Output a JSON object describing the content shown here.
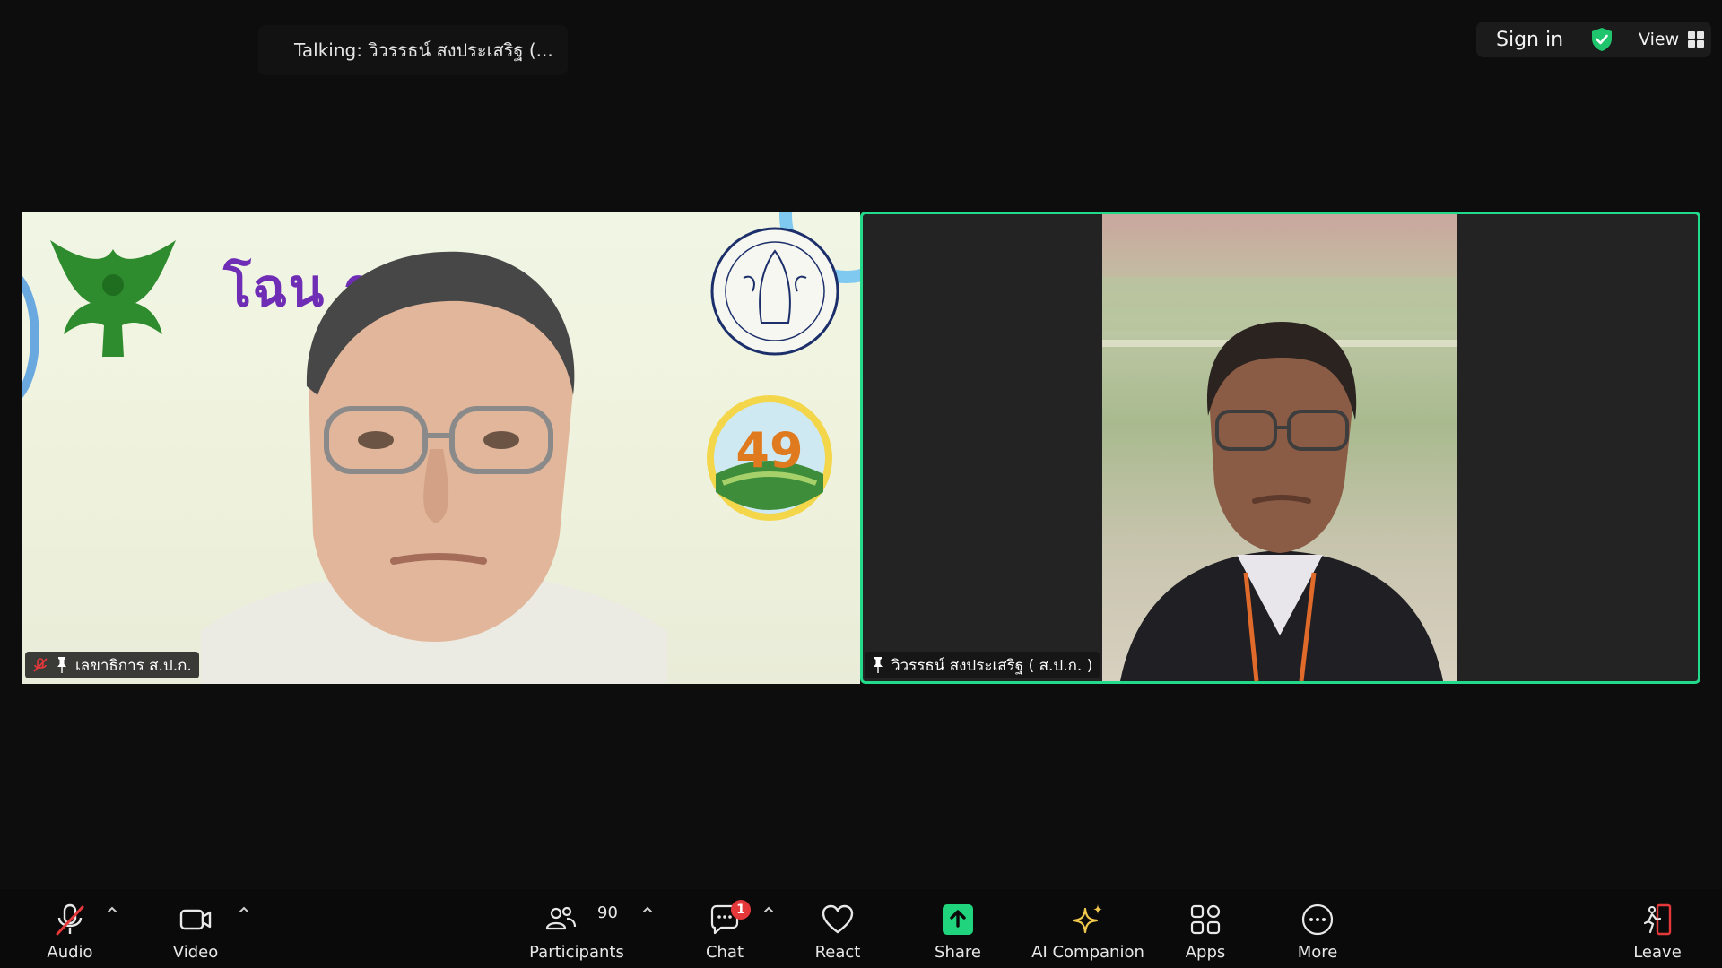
{
  "header": {
    "talking_text": "Talking: วิวรรธน์ สงประเสริฐ (...",
    "sign_in_label": "Sign in",
    "view_label": "View"
  },
  "tiles": [
    {
      "name": "เลขาธิการ ส.ป.ก.",
      "muted": true,
      "banner_text": "โฉน      รเกษตร",
      "seal_number": "49"
    },
    {
      "name": "วิวรรธน์ สงประเสริฐ ( ส.ป.ก. )",
      "active_speaker": true
    }
  ],
  "toolbar": {
    "audio_label": "Audio",
    "video_label": "Video",
    "participants_label": "Participants",
    "participants_count": "90",
    "chat_label": "Chat",
    "chat_badge": "1",
    "react_label": "React",
    "share_label": "Share",
    "ai_label": "AI Companion",
    "apps_label": "Apps",
    "more_label": "More",
    "leave_label": "Leave"
  },
  "colors": {
    "active_border": "#23d98a",
    "share_green": "#1fd47c",
    "mute_red": "#e5383b",
    "ai_gold": "#f2c94c",
    "leave_red": "#e5383b"
  }
}
